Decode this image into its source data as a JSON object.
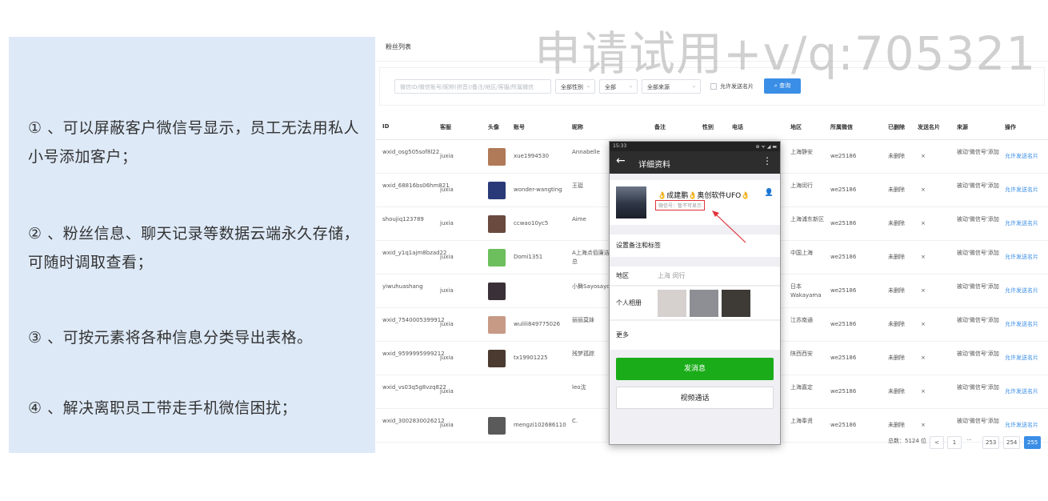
{
  "watermark": "申请试用+v/q:705321",
  "features": [
    "① 、可以屏蔽客户微信号显示，员工无法用私人小号添加客户；",
    "② 、粉丝信息、聊天记录等数据云端永久存储，可随时调取查看；",
    "③ 、可按元素将各种信息分类导出表格。",
    "④ 、解决离职员工带走手机微信困扰；"
  ],
  "page": {
    "title": "粉丝列表",
    "filters": {
      "search_placeholder": "微信ID/微信账号/昵称(拼音)/备注/地区/客服/所属微信",
      "gender": "全部性别",
      "status": "全部",
      "source": "全部来源",
      "allow_card_label": "允许发送名片",
      "query_label": "查询"
    },
    "columns": [
      "ID",
      "客服",
      "头像",
      "账号",
      "昵称",
      "备注",
      "性别",
      "电话",
      "地区",
      "所属微信",
      "已删除",
      "发送名片",
      "来源",
      "操作"
    ],
    "rows": [
      {
        "id": "wxid_osg505sof8l22",
        "agent": "juxia",
        "account": "xue1994530",
        "nickname": "Annabelle",
        "region": "上海静安",
        "owner": "we25186",
        "deleted": "未删除",
        "card": "×",
        "source": "被动'微信号'添加",
        "action": "允许发送名片",
        "avatar": "#b07a58"
      },
      {
        "id": "wxid_68816bs06hm821",
        "agent": "juxia",
        "account": "wonder-wangting",
        "nickname": "王珽",
        "region": "上海闵行",
        "owner": "we25186",
        "deleted": "未删除",
        "card": "×",
        "source": "被动'微信号'添加",
        "action": "允许发送名片",
        "avatar": "#2a3a78"
      },
      {
        "id": "shoujiq123789",
        "agent": "juxia",
        "account": "ccwao10yc5",
        "nickname": "Aime",
        "region": "上海浦东新区",
        "owner": "we25186",
        "deleted": "未删除",
        "card": "×",
        "source": "被动'微信号'添加",
        "action": "允许发送名片",
        "avatar": "#6a4a3e"
      },
      {
        "id": "wxid_y1q1ajm8bzad22",
        "agent": "juxia",
        "account": "Domi1351",
        "nickname": "A上海点佰廉洁部吴总",
        "region": "中国上海",
        "owner": "we25186",
        "deleted": "未删除",
        "card": "×",
        "source": "被动'微信号'添加",
        "action": "允许发送名片",
        "avatar": "#6cbf5c"
      },
      {
        "id": "yiwuhuashang",
        "agent": "juxia",
        "account": "",
        "nickname": "小舞Sayosayo",
        "region": "日本Wakayama",
        "owner": "we25186",
        "deleted": "未删除",
        "card": "×",
        "source": "被动'微信号'添加",
        "action": "允许发送名片",
        "avatar": "#3a3038"
      },
      {
        "id": "wxid_7540005399912",
        "agent": "juxia",
        "account": "wulili849775026",
        "nickname": "丽丽莫妹",
        "region": "江苏南通",
        "owner": "we25186",
        "deleted": "未删除",
        "card": "×",
        "source": "被动'微信号'添加",
        "action": "允许发送名片",
        "avatar": "#c79a86"
      },
      {
        "id": "wxid_9599995999212",
        "agent": "juxia",
        "account": "tx19901225",
        "nickname": "残梦孤踪",
        "region": "陕西西安",
        "owner": "we25186",
        "deleted": "未删除",
        "card": "×",
        "source": "被动'微信号'添加",
        "action": "允许发送名片",
        "avatar": "#4a3a30"
      },
      {
        "id": "wxid_vs03q5g8vzq822",
        "agent": "juxia",
        "account": "",
        "nickname": "leo沈",
        "region": "上海嘉定",
        "owner": "we25186",
        "deleted": "未删除",
        "card": "×",
        "source": "被动'微信号'添加",
        "action": "允许发送名片",
        "avatar": "#ffffff"
      },
      {
        "id": "wxid_3002830026212",
        "agent": "juxia",
        "account": "mengzi102686110",
        "nickname": "C.",
        "region": "上海奉贤",
        "owner": "we25186",
        "deleted": "未删除",
        "card": "×",
        "source": "被动'微信号'添加",
        "action": "允许发送名片",
        "avatar": "#5a5a5a"
      }
    ],
    "pagination": {
      "total": "总数：5124 位",
      "prev": "<",
      "first": "1",
      "ellipsis": "···",
      "p253": "253",
      "p254": "254",
      "p255": "255"
    }
  },
  "phone": {
    "time": "15:33",
    "signal": "⊕ ᯤ ◢ ▬",
    "title": "详细资料",
    "name": "👌成建鹏👌奥创软件UFO👌",
    "wechat_id": "微信号：暂不可显示",
    "set_note": "设置备注和标签",
    "region_label": "地区",
    "region_value": "上海  闵行",
    "album_label": "个人相册",
    "more_label": "更多",
    "send_label": "发消息",
    "video_label": "视频通话"
  },
  "colors": {
    "panel": "#dde9f7",
    "primary": "#3a8ee6",
    "wechat_green": "#1aad19",
    "highlight": "#e0313a"
  }
}
